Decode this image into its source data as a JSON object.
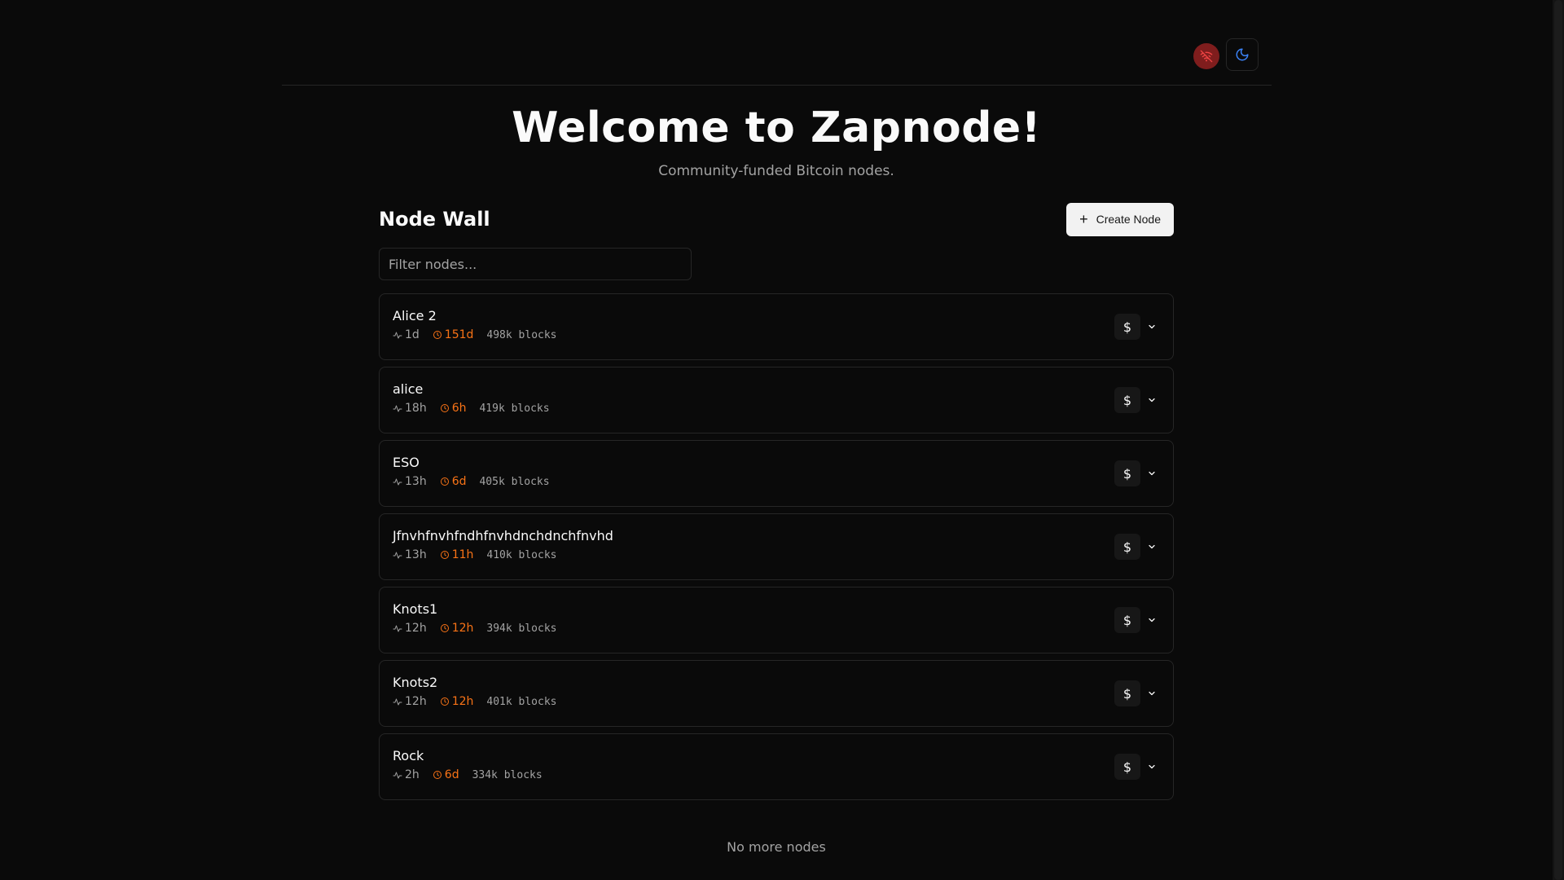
{
  "header": {
    "title": "Welcome to Zapnode!",
    "subtitle": "Community-funded Bitcoin nodes.",
    "icons": {
      "connection": "wifi-off-icon",
      "theme": "moon-icon"
    },
    "colors": {
      "connection_bg": "#7f1d1d",
      "connection_icon": "#ef4444",
      "theme_icon": "#3b82f6"
    }
  },
  "wall": {
    "title": "Node Wall",
    "create_label": "Create Node",
    "filter_placeholder": "Filter nodes...",
    "fund_label": "$",
    "nodes": [
      {
        "name": "Alice 2",
        "uptime": "1d",
        "remaining": "151d",
        "blocks": "498k blocks"
      },
      {
        "name": "alice",
        "uptime": "18h",
        "remaining": "6h",
        "blocks": "419k blocks"
      },
      {
        "name": "ESO",
        "uptime": "13h",
        "remaining": "6d",
        "blocks": "405k blocks"
      },
      {
        "name": "Jfnvhfnvhfndhfnvhdnchdnchfnvhd",
        "uptime": "13h",
        "remaining": "11h",
        "blocks": "410k blocks"
      },
      {
        "name": "Knots1",
        "uptime": "12h",
        "remaining": "12h",
        "blocks": "394k blocks"
      },
      {
        "name": "Knots2",
        "uptime": "12h",
        "remaining": "12h",
        "blocks": "401k blocks"
      },
      {
        "name": "Rock",
        "uptime": "2h",
        "remaining": "6d",
        "blocks": "334k blocks"
      }
    ],
    "end_text": "No more nodes",
    "colors": {
      "remaining": "#f97316",
      "muted": "#a3a3a3"
    }
  }
}
